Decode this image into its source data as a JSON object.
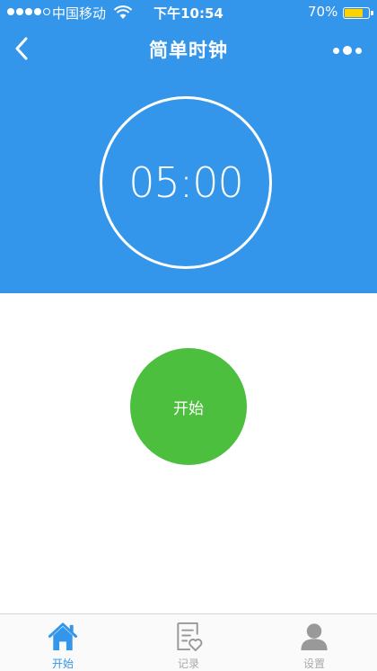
{
  "status_bar": {
    "carrier": "中国移动",
    "time": "下午10:54",
    "battery_percent": "70%",
    "battery_level": 0.7,
    "signal_bars_filled": 4,
    "signal_bars_total": 5
  },
  "nav": {
    "title": "简单时钟"
  },
  "timer": {
    "display": "05:00"
  },
  "actions": {
    "start_label": "开始"
  },
  "tabs": [
    {
      "label": "开始",
      "icon": "home-icon",
      "active": true
    },
    {
      "label": "记录",
      "icon": "record-icon",
      "active": false
    },
    {
      "label": "设置",
      "icon": "user-icon",
      "active": false
    }
  ],
  "colors": {
    "primary": "#3396ea",
    "start_button": "#4cbf3e",
    "tab_inactive": "#aaaaaa"
  }
}
